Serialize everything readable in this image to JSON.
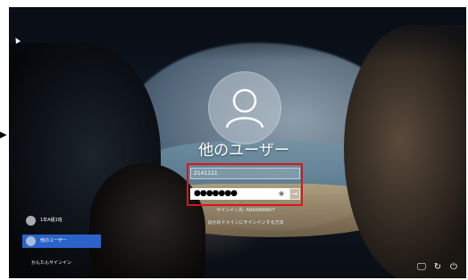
{
  "login": {
    "title": "他のユーザー",
    "username_value": "2141121",
    "password_value": "●●●●●●●",
    "reveal_symbol": "◉",
    "submit_symbol": "→",
    "signin_domain_text": "サインイン先: ARAKAWAKIT",
    "other_signin_text": "ほかのドメインにサインインする方法"
  },
  "user_list": {
    "items": [
      {
        "name": "1年A組1班",
        "selected": false
      },
      {
        "name": "他のユーザー",
        "selected": true
      }
    ],
    "easy_signin": "かんたんサインイン"
  },
  "tray": {
    "network_symbol": "🖵",
    "accessibility_symbol": "↻",
    "power_symbol": "⏻"
  },
  "frame": {
    "left_marker": "▶"
  },
  "colors": {
    "highlight_box": "#d8151b",
    "selected_user_bg": "#2b63c9"
  }
}
